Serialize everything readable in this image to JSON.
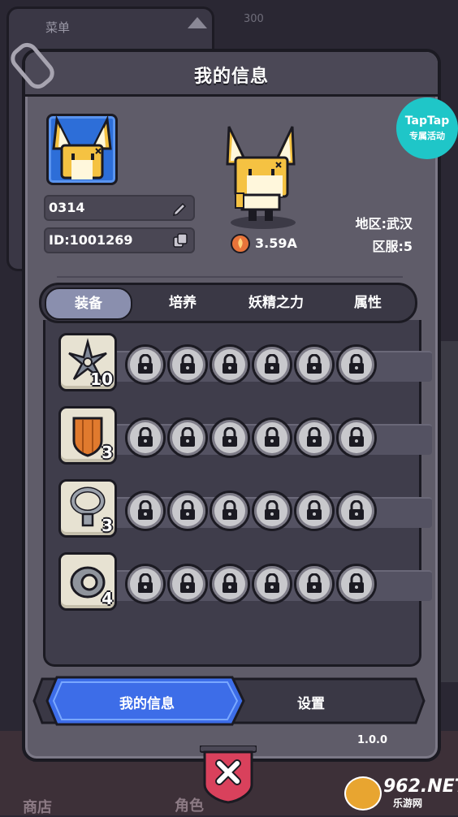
{
  "background": {
    "menu_title": "菜单",
    "coin_count": "300",
    "bottom_shop": "商店",
    "bottom_role": "角色"
  },
  "panel": {
    "title": "我的信息"
  },
  "taptap": {
    "brand": "TapTap",
    "subtitle": "专属活动"
  },
  "profile": {
    "name": "0314",
    "id": "ID:1001269",
    "power": "3.59A",
    "region": "地区:武汉",
    "server": "区服:5"
  },
  "tabs": [
    {
      "label": "装备",
      "active": true
    },
    {
      "label": "培养",
      "active": false
    },
    {
      "label": "妖精之力",
      "active": false
    },
    {
      "label": "属性",
      "active": false
    }
  ],
  "equipment": [
    {
      "icon": "shuriken-icon",
      "level": "10"
    },
    {
      "icon": "shield-icon",
      "level": "3"
    },
    {
      "icon": "necklace-icon",
      "level": "3"
    },
    {
      "icon": "ring-icon",
      "level": "4"
    }
  ],
  "bottom_tabs": {
    "my_info": "我的信息",
    "settings": "设置"
  },
  "version": "1.0.0",
  "watermark": {
    "brand": "962.NET",
    "sub": "乐游网"
  },
  "colors": {
    "panel": "#5f5c69",
    "active_tab": "#3d6de8",
    "close": "#d9415c",
    "taptap": "#1fc6c8"
  }
}
